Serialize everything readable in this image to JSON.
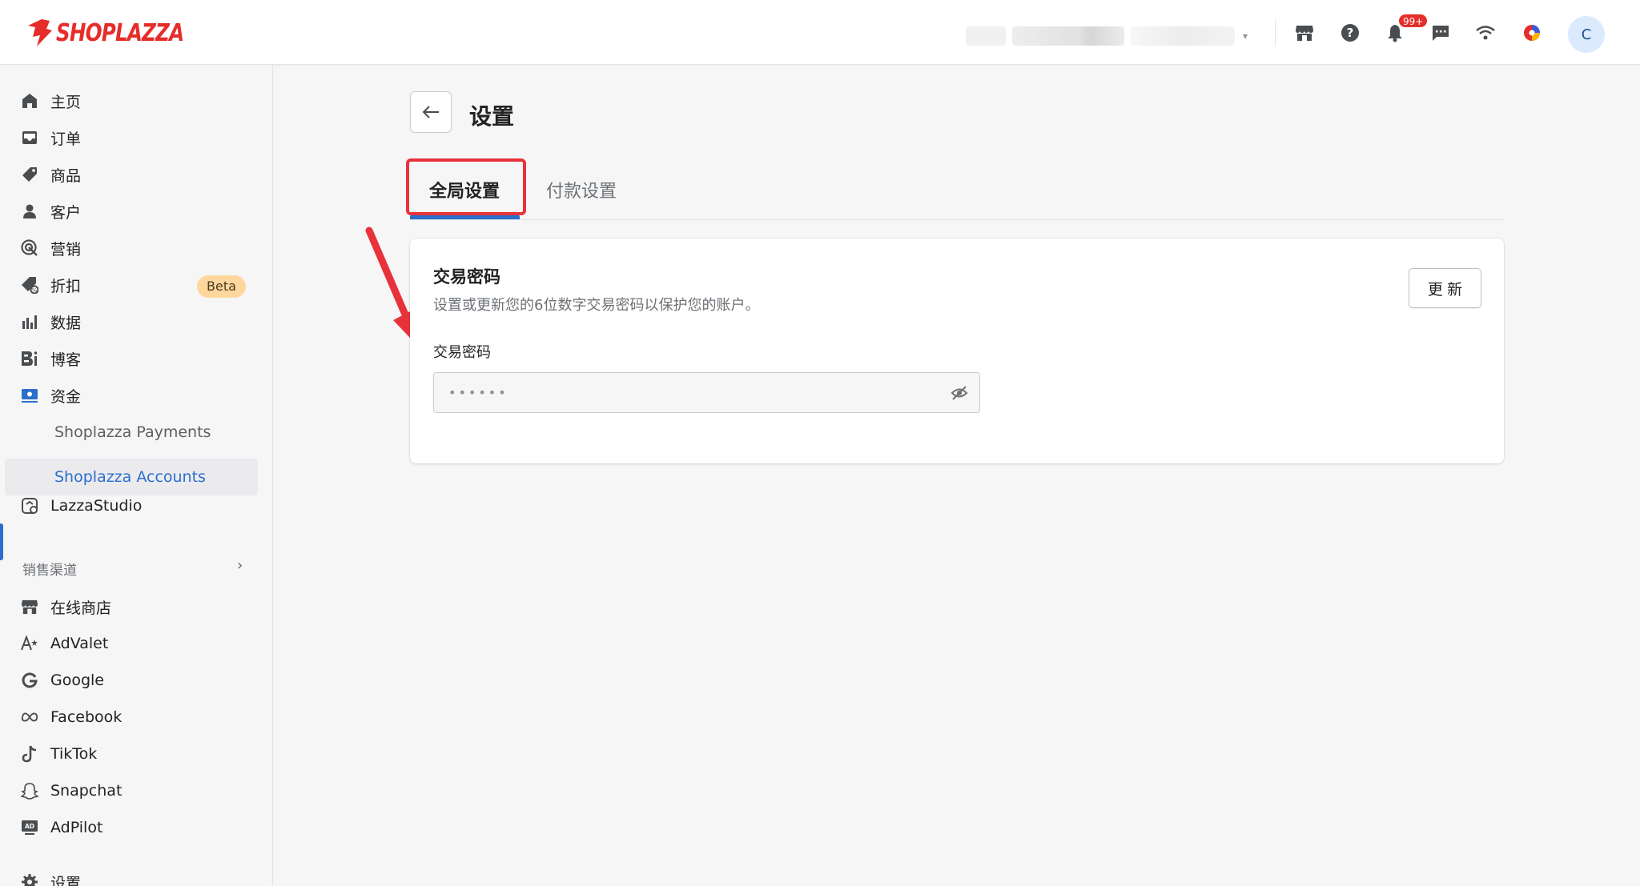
{
  "brand": {
    "name": "SHOPLAZZA",
    "color": "#e52d2a"
  },
  "header": {
    "notifications_badge": "99+",
    "avatar_initial": "C",
    "icons": [
      "store-icon",
      "help-icon",
      "bell-icon",
      "chat-icon",
      "wifi-icon",
      "app-logo-icon"
    ]
  },
  "sidebar": {
    "items": [
      {
        "label": "主页",
        "icon": "home-icon"
      },
      {
        "label": "订单",
        "icon": "inbox-icon"
      },
      {
        "label": "商品",
        "icon": "tag-icon"
      },
      {
        "label": "客户",
        "icon": "person-icon"
      },
      {
        "label": "营销",
        "icon": "target-icon"
      },
      {
        "label": "折扣",
        "icon": "discount-icon",
        "badge": "Beta"
      },
      {
        "label": "数据",
        "icon": "bar-chart-icon"
      },
      {
        "label": "博客",
        "icon": "blog-icon"
      },
      {
        "label": "资金",
        "icon": "money-icon"
      },
      {
        "label": "Shoplazza Payments"
      },
      {
        "label": "Shoplazza Accounts",
        "active": true
      },
      {
        "label": "LazzaStudio",
        "icon": "studio-icon"
      }
    ],
    "section_label": "销售渠道",
    "channels": [
      {
        "label": "在线商店",
        "icon": "store-icon"
      },
      {
        "label": "AdValet",
        "icon": "advalet-icon"
      },
      {
        "label": "Google",
        "icon": "google-icon"
      },
      {
        "label": "Facebook",
        "icon": "meta-icon"
      },
      {
        "label": "TikTok",
        "icon": "tiktok-icon"
      },
      {
        "label": "Snapchat",
        "icon": "snapchat-icon"
      },
      {
        "label": "AdPilot",
        "icon": "adpilot-icon"
      }
    ],
    "settings_label": "设置"
  },
  "page": {
    "title": "设置",
    "tabs": [
      {
        "label": "全局设置",
        "active": true
      },
      {
        "label": "付款设置"
      }
    ]
  },
  "card": {
    "title": "交易密码",
    "description": "设置或更新您的6位数字交易密码以保护您的账户。",
    "update_button": "更 新",
    "field_label": "交易密码",
    "field_value": "••••••"
  },
  "accent_color": "#2c6ecb",
  "highlight_color": "#e8323a"
}
